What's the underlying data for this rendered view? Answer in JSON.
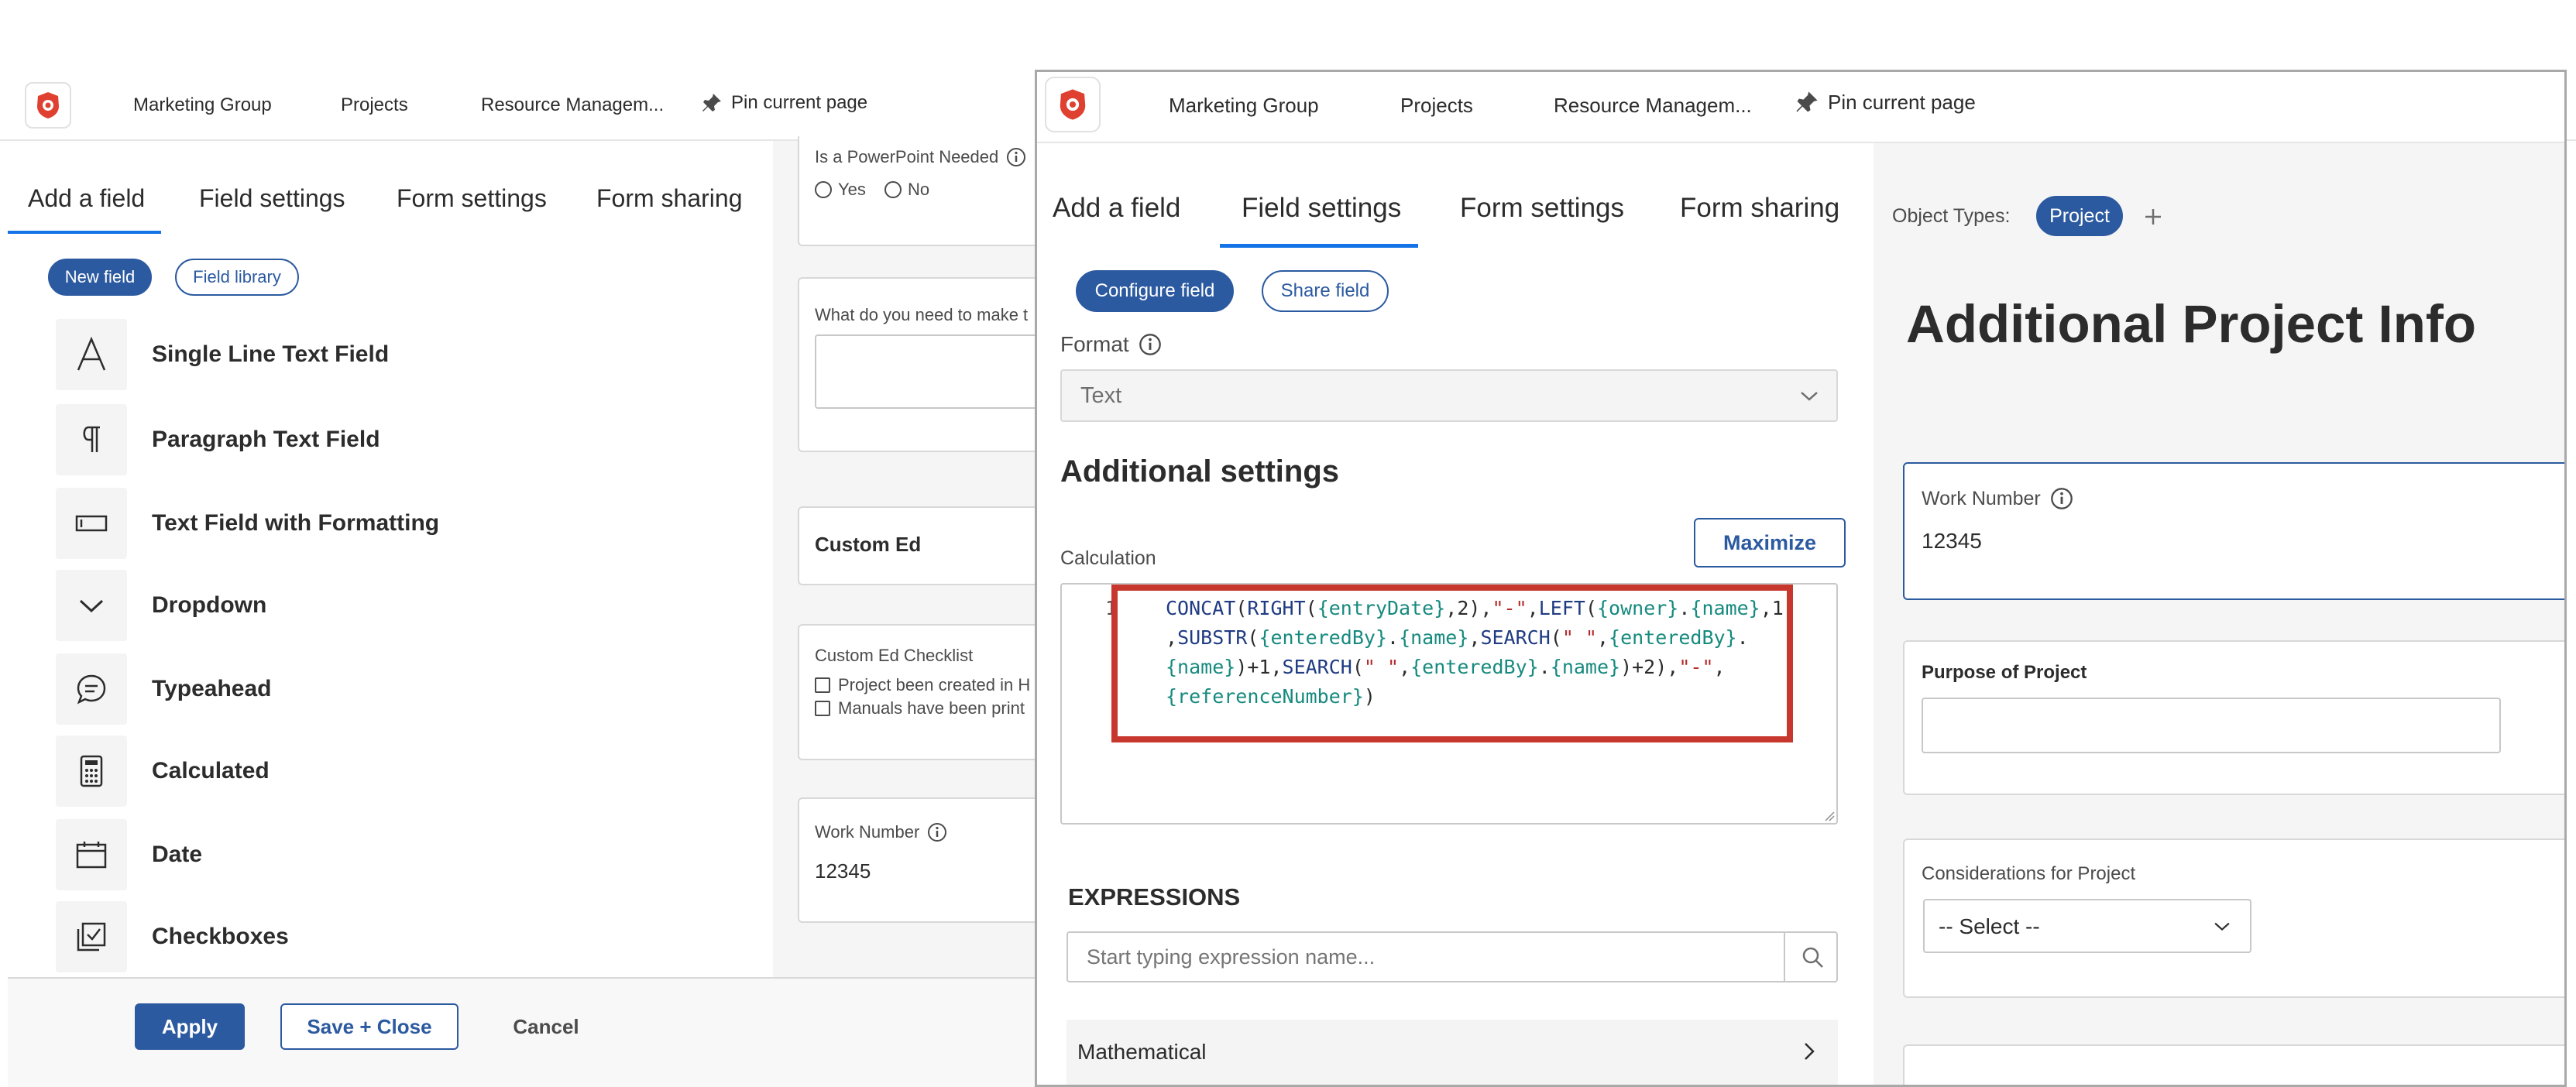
{
  "nav": {
    "items": [
      "Marketing Group",
      "Projects",
      "Resource Managem...",
      "Pin current page"
    ]
  },
  "tabs": [
    "Add a field",
    "Field settings",
    "Form settings",
    "Form sharing"
  ],
  "left_panel": {
    "pills": {
      "new_field": "New field",
      "field_library": "Field library"
    },
    "fields": [
      {
        "label": "Single Line Text Field",
        "icon": "single-line-text-icon"
      },
      {
        "label": "Paragraph Text Field",
        "icon": "paragraph-icon"
      },
      {
        "label": "Text Field with Formatting",
        "icon": "text-formatting-icon"
      },
      {
        "label": "Dropdown",
        "icon": "chevron-down-icon"
      },
      {
        "label": "Typeahead",
        "icon": "typeahead-icon"
      },
      {
        "label": "Calculated",
        "icon": "calculator-icon"
      },
      {
        "label": "Date",
        "icon": "calendar-icon"
      },
      {
        "label": "Checkboxes",
        "icon": "checkboxes-icon"
      }
    ]
  },
  "background_form": {
    "powerpoint_label": "Is a PowerPoint Needed",
    "yes": "Yes",
    "no": "No",
    "what_do_you_need": "What do you need to make t",
    "custom_ed": "Custom Ed",
    "checklist_label": "Custom Ed Checklist",
    "check1": "Project been created in H",
    "check2": "Manuals have been print",
    "work_number_label": "Work Number",
    "work_number_value": "12345"
  },
  "bottom_bar": {
    "apply": "Apply",
    "save_close": "Save + Close",
    "cancel": "Cancel"
  },
  "overlay": {
    "pills": {
      "configure": "Configure field",
      "share": "Share field"
    },
    "format_label": "Format",
    "format_value": "Text",
    "additional_settings": "Additional settings",
    "calculation_label": "Calculation",
    "maximize": "Maximize",
    "line_number": "1",
    "expressions_title": "EXPRESSIONS",
    "expressions_placeholder": "Start typing expression name...",
    "mathematical": "Mathematical",
    "object_types_label": "Object Types:",
    "object_type": "Project",
    "form_title": "Additional Project Info",
    "work_number_label": "Work Number",
    "work_number_value": "12345",
    "purpose_label": "Purpose of Project",
    "considerations_label": "Considerations for Project",
    "select_placeholder": "-- Select --"
  },
  "colors": {
    "accent": "#2c5aa0",
    "highlight": "#c8372d",
    "tab_underline": "#1473e6"
  }
}
